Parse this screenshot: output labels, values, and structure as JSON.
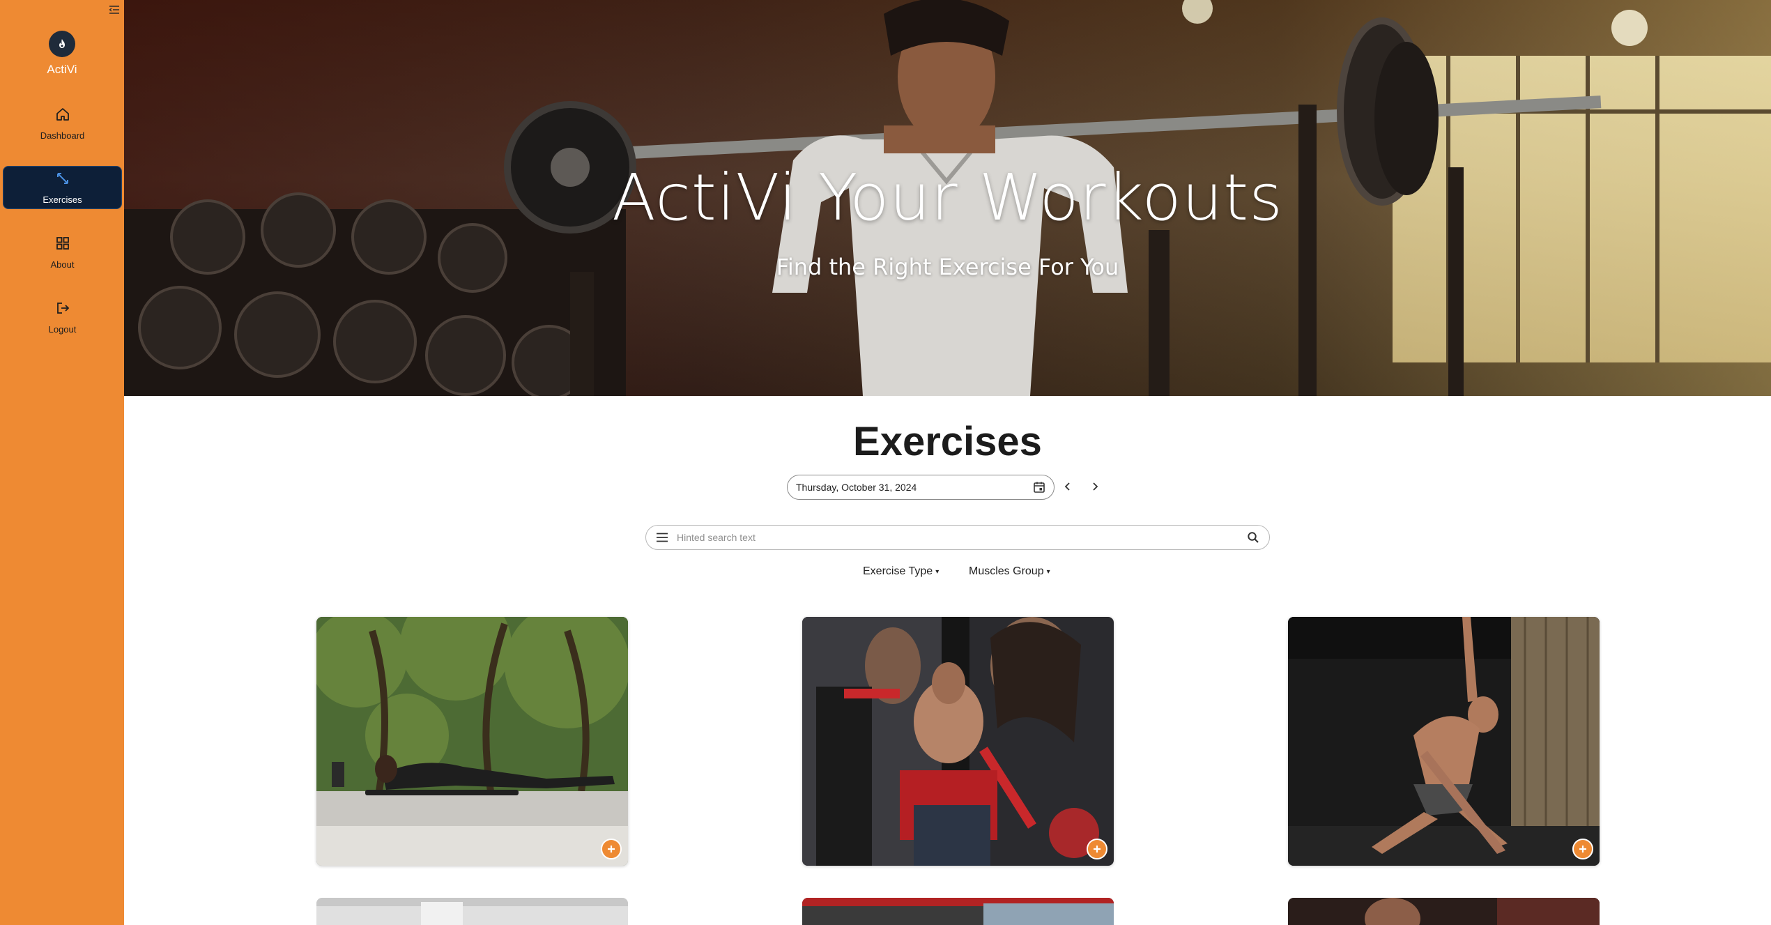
{
  "sidebar": {
    "brand": "ActiVi",
    "items": [
      {
        "label": "Dashboard",
        "icon": "home-icon"
      },
      {
        "label": "Exercises",
        "icon": "arrows-icon",
        "active": true
      },
      {
        "label": "About",
        "icon": "grid-icon"
      },
      {
        "label": "Logout",
        "icon": "logout-icon"
      }
    ]
  },
  "hero": {
    "title": "ActiVi Your Workouts",
    "subtitle": "Find the Right Exercise For You"
  },
  "main": {
    "title": "Exercises",
    "date": "Thursday, October 31, 2024",
    "search_placeholder": "Hinted search text",
    "filters": [
      "Exercise Type",
      "Muscles Group"
    ]
  },
  "cards": [
    {
      "scene": "woman planking on mat in forest"
    },
    {
      "scene": "man using chest machine in red gym"
    },
    {
      "scene": "man stretching side bend in dark gym"
    }
  ],
  "colors": {
    "sidebar": "#ee8a33",
    "active_nav": "#0d1f38",
    "accent": "#ee8a33"
  }
}
